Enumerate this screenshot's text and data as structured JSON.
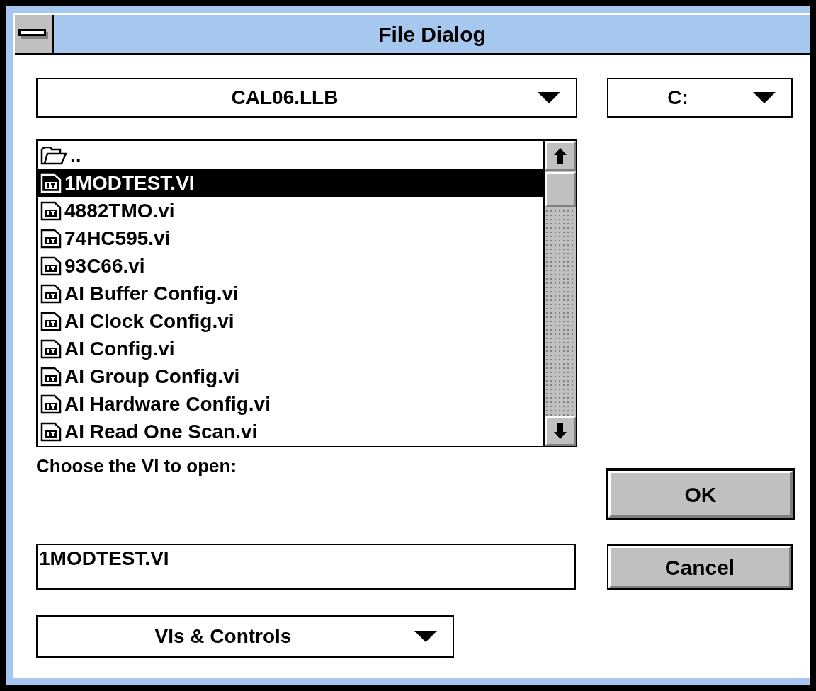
{
  "window": {
    "title": "File Dialog"
  },
  "path_dropdown": {
    "value": "CAL06.LLB"
  },
  "drive_dropdown": {
    "value": "C:"
  },
  "file_list": {
    "items": [
      {
        "kind": "folder",
        "label": "..",
        "selected": false
      },
      {
        "kind": "vi",
        "label": "1MODTEST.VI",
        "selected": true
      },
      {
        "kind": "vi",
        "label": "4882TMO.vi",
        "selected": false
      },
      {
        "kind": "vi",
        "label": "74HC595.vi",
        "selected": false
      },
      {
        "kind": "vi",
        "label": "93C66.vi",
        "selected": false
      },
      {
        "kind": "vi",
        "label": "AI Buffer Config.vi",
        "selected": false
      },
      {
        "kind": "vi",
        "label": "AI Clock Config.vi",
        "selected": false
      },
      {
        "kind": "vi",
        "label": "AI Config.vi",
        "selected": false
      },
      {
        "kind": "vi",
        "label": "AI Group Config.vi",
        "selected": false
      },
      {
        "kind": "vi",
        "label": "AI Hardware Config.vi",
        "selected": false
      },
      {
        "kind": "vi",
        "label": "AI Read One Scan.vi",
        "selected": false
      }
    ]
  },
  "prompt": "Choose the VI to open:",
  "filename_field": {
    "value": "1MODTEST.VI"
  },
  "buttons": [
    {
      "label": "OK",
      "default": true
    },
    {
      "label": "Cancel",
      "default": false
    }
  ],
  "filter_dropdown": {
    "value": "VIs & Controls"
  }
}
